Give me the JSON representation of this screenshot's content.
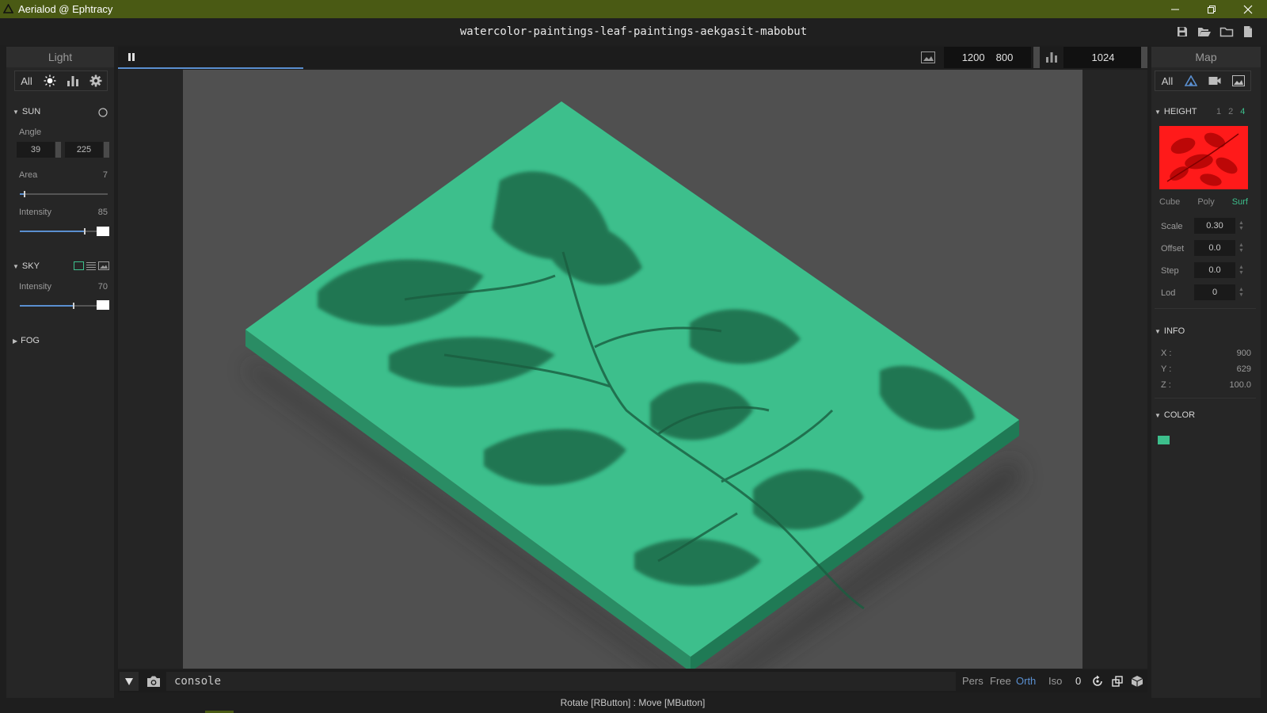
{
  "window": {
    "title": "Aerialod @ Ephtracy",
    "accent": "#4a5a14"
  },
  "document": {
    "title": "watercolor-paintings-leaf-paintings-aekgasit-mabobut"
  },
  "left_panel": {
    "title": "Light",
    "tabs": [
      {
        "label": "All",
        "icon": ""
      },
      {
        "label": "",
        "icon": "sun-icon"
      },
      {
        "label": "",
        "icon": "histogram-icon"
      },
      {
        "label": "",
        "icon": "gear-icon"
      }
    ],
    "sun": {
      "title": "SUN",
      "angle_label": "Angle",
      "angle_values": [
        "39",
        "225"
      ],
      "area_label": "Area",
      "area_value": "7",
      "area_level": 0.05,
      "intensity_label": "Intensity",
      "intensity_value": "85",
      "intensity_level": 0.85
    },
    "sky": {
      "title": "SKY",
      "intensity_label": "Intensity",
      "intensity_value": "70",
      "intensity_level": 0.7
    },
    "fog": {
      "title": "FOG"
    }
  },
  "viewport": {
    "resolution": {
      "width": "1200",
      "height": "800"
    },
    "sample_size": "1024",
    "progress": 0.18,
    "model_color": "#3dbf8c",
    "background_color": "#505050"
  },
  "right_panel": {
    "title": "Map",
    "tabs": [
      {
        "label": "All",
        "icon": ""
      },
      {
        "label": "",
        "icon": "terrain-icon"
      },
      {
        "label": "",
        "icon": "camera-icon"
      },
      {
        "label": "",
        "icon": "image-icon"
      }
    ],
    "height": {
      "title": "HEIGHT",
      "levels": [
        "1",
        "2",
        "4"
      ],
      "active_level": "4",
      "modes": [
        "Cube",
        "Poly",
        "Surf"
      ],
      "active_mode": "Surf",
      "fields": [
        {
          "label": "Scale",
          "value": "0.30"
        },
        {
          "label": "Offset",
          "value": "0.0"
        },
        {
          "label": "Step",
          "value": "0.0"
        },
        {
          "label": "Lod",
          "value": "0"
        }
      ]
    },
    "info": {
      "title": "INFO",
      "rows": [
        {
          "label": "X :",
          "value": "900"
        },
        {
          "label": "Y :",
          "value": "629"
        },
        {
          "label": "Z :",
          "value": "100.0"
        }
      ]
    },
    "color": {
      "title": "COLOR",
      "swatch": "#3dbf8c"
    }
  },
  "bottom": {
    "console_text": "console",
    "view_modes": [
      "Pers",
      "Free",
      "Orth",
      "Iso"
    ],
    "active_view": "Orth",
    "counter": "0"
  },
  "status": {
    "text": "Rotate [RButton] : Move [MButton]"
  }
}
